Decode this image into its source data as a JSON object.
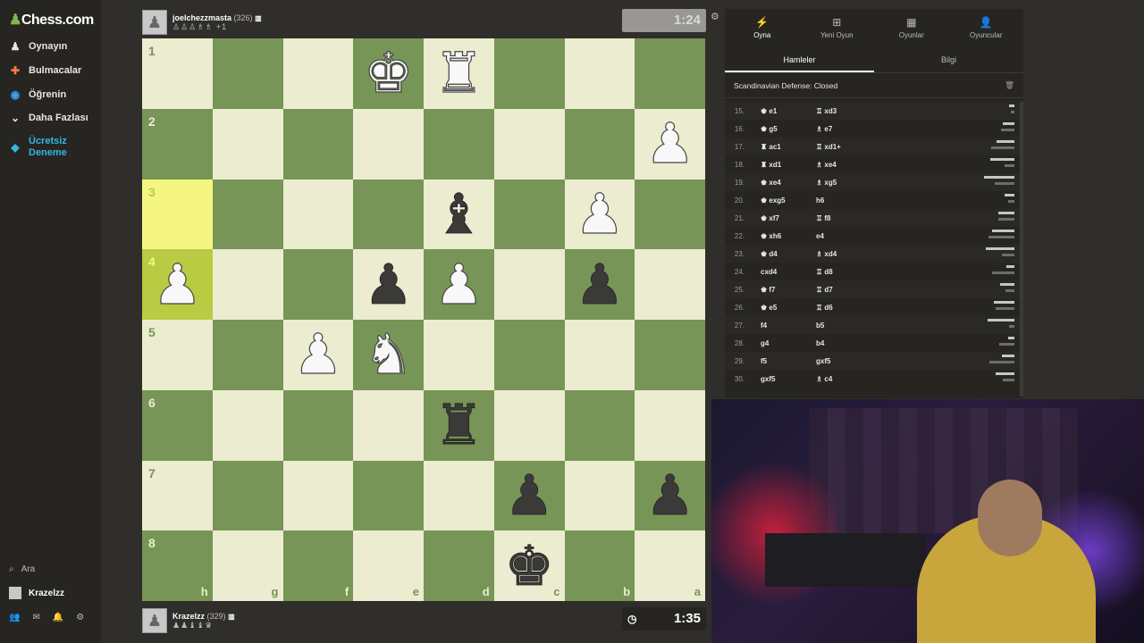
{
  "nav": {
    "logo": "Chess.com",
    "items": [
      {
        "label": "Oynayın",
        "icon": "play-icon",
        "glyph": "♟"
      },
      {
        "label": "Bulmacalar",
        "icon": "puzzle-icon",
        "glyph": "✚"
      },
      {
        "label": "Öğrenin",
        "icon": "learn-icon",
        "glyph": "◉"
      },
      {
        "label": "Daha Fazlası",
        "icon": "more-icon",
        "glyph": "⌄"
      },
      {
        "label": "Ücretsiz Deneme",
        "icon": "diamond-icon",
        "glyph": "◆"
      }
    ],
    "search_label": "Ara",
    "user_label": "Krazelzz"
  },
  "top_player": {
    "name": "joelchezzmasta",
    "rating": "(326)",
    "captured": "♙♙♙♗♗ +1",
    "clock": "1:24",
    "clock_active": false
  },
  "bottom_player": {
    "name": "Krazelzz",
    "rating": "(329)",
    "captured": "♟♟♝♝♛",
    "clock": "1:35",
    "clock_active": true
  },
  "board": {
    "ranks": [
      "1",
      "2",
      "3",
      "4",
      "5",
      "6",
      "7",
      "8"
    ],
    "files": [
      "h",
      "g",
      "f",
      "e",
      "d",
      "c",
      "b",
      "a"
    ],
    "highlight": [
      [
        2,
        0
      ],
      [
        3,
        0
      ]
    ],
    "pieces": [
      {
        "r": 0,
        "c": 3,
        "p": "♚",
        "side": "w"
      },
      {
        "r": 0,
        "c": 4,
        "p": "♜",
        "side": "w"
      },
      {
        "r": 1,
        "c": 7,
        "p": "♟",
        "side": "w"
      },
      {
        "r": 2,
        "c": 4,
        "p": "♝",
        "side": "b"
      },
      {
        "r": 2,
        "c": 6,
        "p": "♟",
        "side": "w"
      },
      {
        "r": 3,
        "c": 0,
        "p": "♟",
        "side": "w"
      },
      {
        "r": 3,
        "c": 3,
        "p": "♟",
        "side": "b"
      },
      {
        "r": 3,
        "c": 4,
        "p": "♟",
        "side": "w"
      },
      {
        "r": 3,
        "c": 6,
        "p": "♟",
        "side": "b"
      },
      {
        "r": 4,
        "c": 2,
        "p": "♟",
        "side": "w"
      },
      {
        "r": 4,
        "c": 3,
        "p": "♞",
        "side": "w"
      },
      {
        "r": 5,
        "c": 4,
        "p": "♜",
        "side": "b"
      },
      {
        "r": 6,
        "c": 5,
        "p": "♟",
        "side": "b"
      },
      {
        "r": 6,
        "c": 7,
        "p": "♟",
        "side": "b"
      },
      {
        "r": 7,
        "c": 5,
        "p": "♚",
        "side": "b"
      }
    ]
  },
  "panel": {
    "top_tabs": [
      {
        "label": "Oyna",
        "icon": "lightning-icon",
        "glyph": "⚡",
        "active": true
      },
      {
        "label": "Yeni Oyun",
        "icon": "plus-icon",
        "glyph": "⊞",
        "active": false
      },
      {
        "label": "Oyunlar",
        "icon": "board-icon",
        "glyph": "▦",
        "active": false
      },
      {
        "label": "Oyuncular",
        "icon": "players-icon",
        "glyph": "👤",
        "active": false
      }
    ],
    "sub_tabs": [
      {
        "label": "Hamleler",
        "active": true
      },
      {
        "label": "Bilgi",
        "active": false
      }
    ],
    "opening": "Scandinavian Defense: Closed",
    "moves": [
      {
        "n": "15.",
        "w": "♚ e1",
        "b": "♖ xd3"
      },
      {
        "n": "16.",
        "w": "♚ g5",
        "b": "♗ e7"
      },
      {
        "n": "17.",
        "w": "♜ ac1",
        "b": "♖ xd1+"
      },
      {
        "n": "18.",
        "w": "♜ xd1",
        "b": "♗ xe4"
      },
      {
        "n": "19.",
        "w": "♚ xe4",
        "b": "♗ xg5"
      },
      {
        "n": "20.",
        "w": "♚ exg5",
        "b": "h6"
      },
      {
        "n": "21.",
        "w": "♚ xf7",
        "b": "♖ f8"
      },
      {
        "n": "22.",
        "w": "♚ xh6",
        "b": "e4"
      },
      {
        "n": "23.",
        "w": "♚ d4",
        "b": "♗ xd4"
      },
      {
        "n": "24.",
        "w": "cxd4",
        "b": "♖ d8"
      },
      {
        "n": "25.",
        "w": "♚ f7",
        "b": "♖ d7"
      },
      {
        "n": "26.",
        "w": "♚ e5",
        "b": "♖ d6"
      },
      {
        "n": "27.",
        "w": "f4",
        "b": "b5"
      },
      {
        "n": "28.",
        "w": "g4",
        "b": "b4"
      },
      {
        "n": "29.",
        "w": "f5",
        "b": "gxf5"
      },
      {
        "n": "30.",
        "w": "gxf5",
        "b": "♗ c4"
      }
    ]
  }
}
